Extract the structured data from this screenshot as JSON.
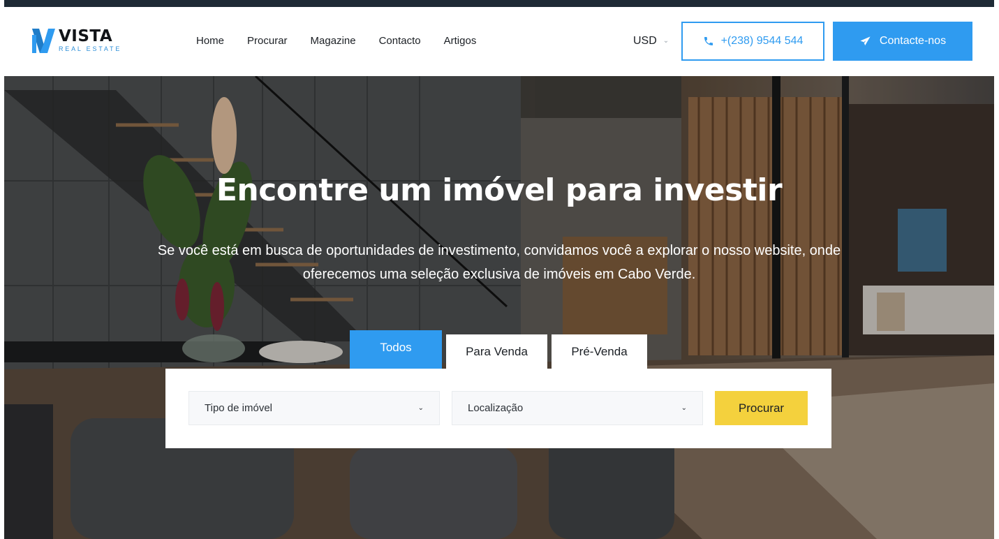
{
  "brand": {
    "name": "VISTA",
    "tagline": "REAL ESTATE",
    "logo_icon": "v-logo-icon",
    "accent": "#2f9bf0"
  },
  "nav": {
    "links": [
      "Home",
      "Procurar",
      "Magazine",
      "Contacto",
      "Artigos"
    ]
  },
  "header": {
    "currency": "USD",
    "currency_icon": "chevron-down-icon",
    "phone": "+(238) 9544 544",
    "phone_icon": "phone-icon",
    "contact_label": "Contacte-nos",
    "contact_icon": "paper-plane-icon"
  },
  "hero": {
    "title": "Encontre um imóvel para investir",
    "subtitle": "Se você está em busca de oportunidades de investimento, convidamos você a explorar o nosso website, onde oferecemos uma seleção exclusiva de imóveis em Cabo Verde."
  },
  "search": {
    "tabs": [
      "Todos",
      "Para Venda",
      "Pré-Venda"
    ],
    "active_tab": "Todos",
    "property_type": "Tipo de imóvel",
    "location": "Localização",
    "button_label": "Procurar",
    "button_color": "#f4d13d"
  }
}
